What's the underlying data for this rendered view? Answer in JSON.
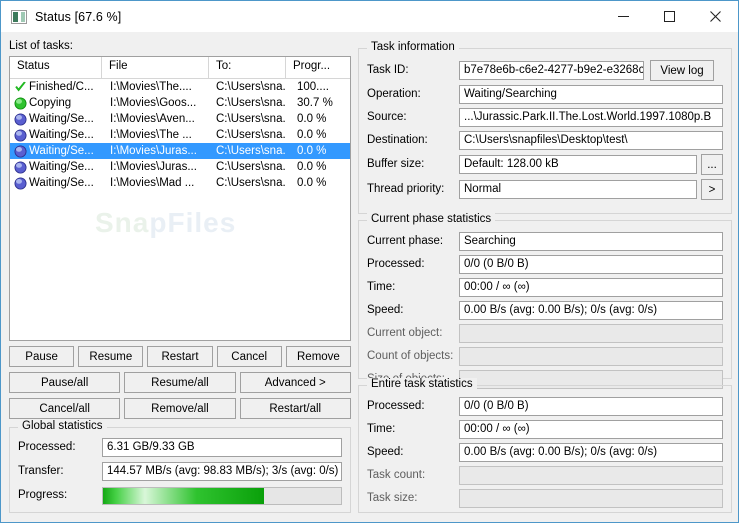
{
  "window": {
    "title": "Status [67.6 %]",
    "icon": "app-window-icon",
    "minimize": "—",
    "maximize": "□",
    "close": "✕",
    "accent": "#4d97c9",
    "watermark_a": "Sna",
    "watermark_b": "pFiles"
  },
  "tasks_panel": {
    "label": "List of tasks:",
    "columns": [
      "Status",
      "File",
      "To:",
      "Progr..."
    ],
    "rows": [
      {
        "icon": "check-icon",
        "status": "Finished/C...",
        "file": "I:\\Movies\\The....",
        "to": "C:\\Users\\sna...",
        "progress": "100....",
        "selected": false
      },
      {
        "icon": "sphere-green-icon",
        "status": "Copying",
        "file": "I:\\Movies\\Goos...",
        "to": "C:\\Users\\sna...",
        "progress": "30.7 %",
        "selected": false
      },
      {
        "icon": "sphere-blue-icon",
        "status": "Waiting/Se...",
        "file": "I:\\Movies\\Aven...",
        "to": "C:\\Users\\sna...",
        "progress": "0.0 %",
        "selected": false
      },
      {
        "icon": "sphere-blue-icon",
        "status": "Waiting/Se...",
        "file": "I:\\Movies\\The ...",
        "to": "C:\\Users\\sna...",
        "progress": "0.0 %",
        "selected": false
      },
      {
        "icon": "sphere-blue-icon",
        "status": "Waiting/Se...",
        "file": "I:\\Movies\\Juras...",
        "to": "C:\\Users\\sna...",
        "progress": "0.0 %",
        "selected": true
      },
      {
        "icon": "sphere-blue-icon",
        "status": "Waiting/Se...",
        "file": "I:\\Movies\\Juras...",
        "to": "C:\\Users\\sna...",
        "progress": "0.0 %",
        "selected": false
      },
      {
        "icon": "sphere-blue-icon",
        "status": "Waiting/Se...",
        "file": "I:\\Movies\\Mad ...",
        "to": "C:\\Users\\sna...",
        "progress": "0.0 %",
        "selected": false
      }
    ]
  },
  "actions": {
    "row1": [
      "Pause",
      "Resume",
      "Restart",
      "Cancel",
      "Remove"
    ],
    "row2": [
      "Pause/all",
      "Resume/all",
      "Advanced >"
    ],
    "row3": [
      "Cancel/all",
      "Remove/all",
      "Restart/all"
    ]
  },
  "global_statistics": {
    "title": "Global statistics",
    "processed_label": "Processed:",
    "processed_value": "6.31 GB/9.33 GB",
    "transfer_label": "Transfer:",
    "transfer_value": "144.57 MB/s (avg: 98.83 MB/s); 3/s (avg: 0/s)",
    "progress_label": "Progress:",
    "progress_percent": 67.6
  },
  "task_information": {
    "title": "Task information",
    "task_id_label": "Task ID:",
    "task_id_value": "b7e78e6b-c6e2-4277-b9e2-e3268c",
    "view_log_label": "View log",
    "operation_label": "Operation:",
    "operation_value": "Waiting/Searching",
    "source_label": "Source:",
    "source_value": "...\\Jurassic.Park.II.The.Lost.World.1997.1080p.B",
    "destination_label": "Destination:",
    "destination_value": "C:\\Users\\snapfiles\\Desktop\\test\\",
    "buffer_size_label": "Buffer size:",
    "buffer_size_value": "Default: 128.00 kB",
    "buffer_browse_label": "...",
    "thread_priority_label": "Thread priority:",
    "thread_priority_value": "Normal",
    "thread_more_label": ">"
  },
  "current_phase_statistics": {
    "title": "Current phase statistics",
    "rows": [
      {
        "label": "Current phase:",
        "value": "Searching",
        "disabled": false
      },
      {
        "label": "Processed:",
        "value": "0/0 (0 B/0 B)",
        "disabled": false
      },
      {
        "label": "Time:",
        "value": "00:00 / ∞ (∞)",
        "disabled": false
      },
      {
        "label": "Speed:",
        "value": "0.00 B/s (avg: 0.00 B/s); 0/s (avg: 0/s)",
        "disabled": false
      },
      {
        "label": "Current object:",
        "value": "",
        "disabled": true
      },
      {
        "label": "Count of objects:",
        "value": "",
        "disabled": true
      },
      {
        "label": "Size of objects:",
        "value": "",
        "disabled": true
      }
    ]
  },
  "entire_task_statistics": {
    "title": "Entire task statistics",
    "rows": [
      {
        "label": "Processed:",
        "value": "0/0 (0 B/0 B)",
        "disabled": false
      },
      {
        "label": "Time:",
        "value": "00:00 / ∞ (∞)",
        "disabled": false
      },
      {
        "label": "Speed:",
        "value": "0.00 B/s (avg: 0.00 B/s); 0/s (avg: 0/s)",
        "disabled": false
      },
      {
        "label": "Task count:",
        "value": "",
        "disabled": true
      },
      {
        "label": "Task size:",
        "value": "",
        "disabled": true
      }
    ]
  }
}
